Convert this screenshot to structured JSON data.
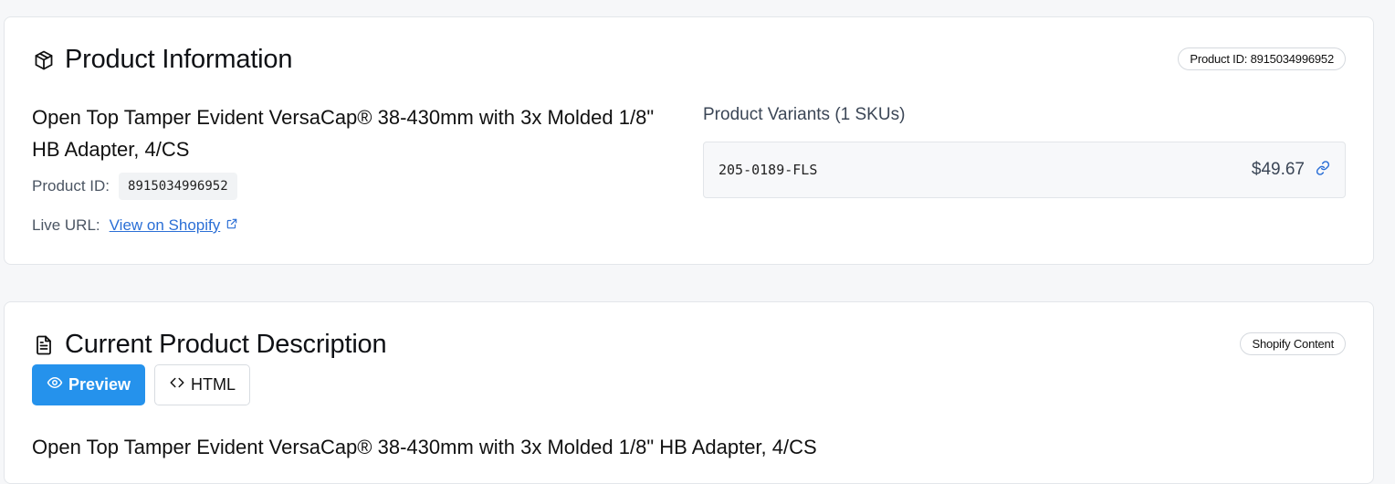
{
  "product_info": {
    "title": "Product Information",
    "id_badge": "Product ID: 8915034996952",
    "name": "Open Top Tamper Evident VersaCap® 38-430mm with 3x Molded 1/8\" HB Adapter, 4/CS",
    "id_label": "Product ID:",
    "id_value": "8915034996952",
    "url_label": "Live URL:",
    "url_link_text": "View on Shopify",
    "icons": {
      "title_icon": "package-icon",
      "link_icon": "external-link-icon"
    }
  },
  "variants": {
    "title": "Product Variants (1 SKUs)",
    "items": [
      {
        "sku": "205-0189-FLS",
        "price": "$49.67"
      }
    ],
    "icons": {
      "variant_link": "link-icon"
    }
  },
  "description": {
    "title": "Current Product Description",
    "badge": "Shopify Content",
    "tabs": [
      {
        "label": "Preview",
        "icon": "eye-icon",
        "active": true
      },
      {
        "label": "HTML",
        "icon": "code-icon",
        "active": false
      }
    ],
    "heading": "Open Top Tamper Evident VersaCap® 38-430mm with 3x Molded 1/8\" HB Adapter, 4/CS",
    "icons": {
      "title_icon": "document-icon"
    }
  },
  "colors": {
    "accent": "#2592ec",
    "link": "#2b6fd6",
    "card_border": "#e3e6ea",
    "page_bg": "#f6f7f9"
  }
}
